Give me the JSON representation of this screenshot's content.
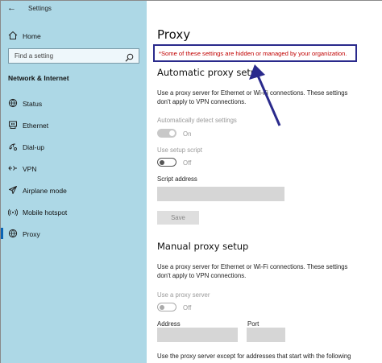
{
  "window": {
    "title": "Settings",
    "back_glyph": "←"
  },
  "sidebar": {
    "home_label": "Home",
    "search_placeholder": "Find a setting",
    "section_title": "Network & Internet",
    "items": [
      {
        "label": "Status",
        "icon": "globe-status-icon"
      },
      {
        "label": "Ethernet",
        "icon": "ethernet-icon"
      },
      {
        "label": "Dial-up",
        "icon": "dialup-icon"
      },
      {
        "label": "VPN",
        "icon": "vpn-icon"
      },
      {
        "label": "Airplane mode",
        "icon": "airplane-icon"
      },
      {
        "label": "Mobile hotspot",
        "icon": "hotspot-icon"
      },
      {
        "label": "Proxy",
        "icon": "globe-icon"
      }
    ],
    "active_item": "Proxy"
  },
  "main": {
    "title": "Proxy",
    "notice": "*Some of these settings are hidden or managed by your organization.",
    "automatic": {
      "heading": "Automatic proxy setup",
      "description": "Use a proxy server for Ethernet or Wi-Fi connections. These settings don't apply to VPN connections.",
      "auto_detect_label": "Automatically detect settings",
      "auto_detect_state": "On",
      "setup_script_label": "Use setup script",
      "setup_script_state": "Off",
      "script_address_label": "Script address",
      "script_address_value": "",
      "save_label": "Save"
    },
    "manual": {
      "heading": "Manual proxy setup",
      "description": "Use a proxy server for Ethernet or Wi-Fi connections. These settings don't apply to VPN connections.",
      "use_proxy_label": "Use a proxy server",
      "use_proxy_state": "Off",
      "address_label": "Address",
      "address_value": "",
      "port_label": "Port",
      "port_value": "",
      "exceptions_text": "Use the proxy server except for addresses that start with the following"
    }
  },
  "colors": {
    "sidebar_bg": "#add8e6",
    "notice_text": "#c00000",
    "notice_border": "#2a2a8c",
    "annotation_arrow": "#2a2a8c",
    "active_indicator": "#0a64b4"
  }
}
